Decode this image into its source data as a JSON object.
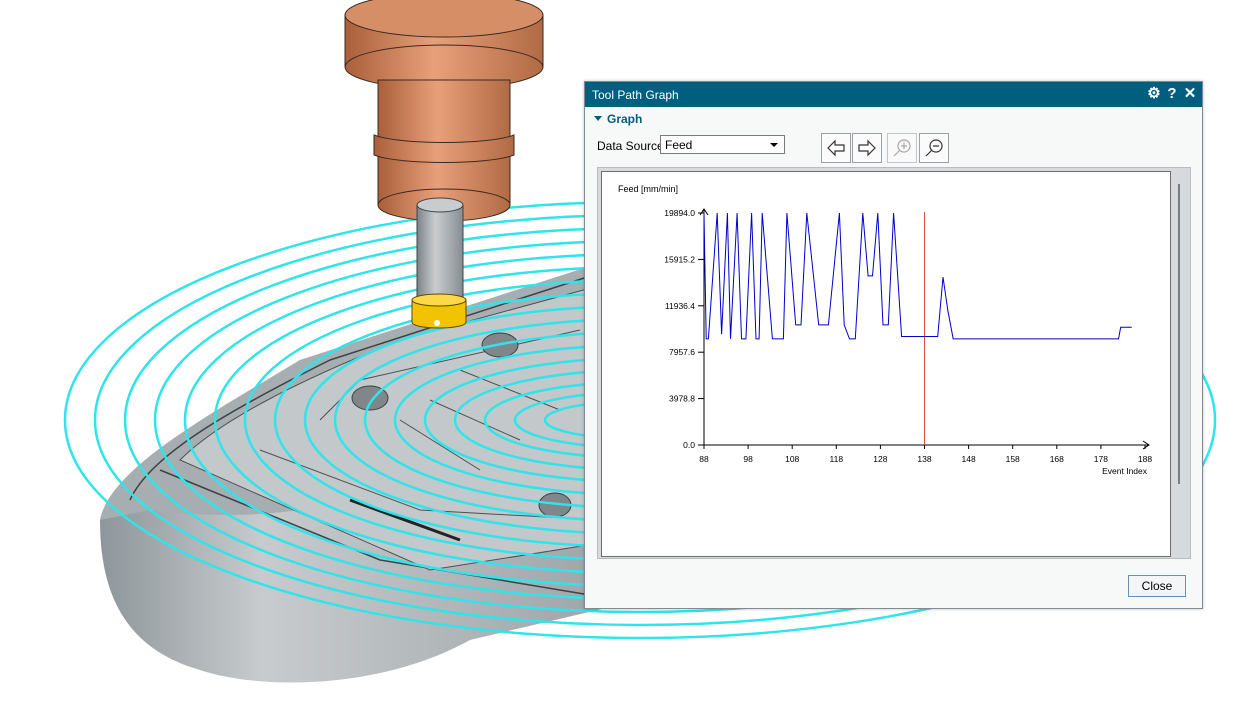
{
  "dialog": {
    "title": "Tool Path Graph",
    "icons": [
      "gear-icon",
      "help-icon",
      "close-icon"
    ],
    "group_label": "Graph",
    "data_source_label": "Data Source",
    "data_source_value": "Feed",
    "toolbar": [
      "arrow-left-icon",
      "arrow-right-icon",
      "zoom-in-icon",
      "zoom-out-icon"
    ],
    "close_label": "Close",
    "accent_color": "#005f7f"
  },
  "chart_data": {
    "type": "line",
    "ylabel": "Feed [mm/min]",
    "xlabel": "Event Index",
    "yticks": [
      "0.0",
      "3978.8",
      "7957.6",
      "11936.4",
      "15915.2",
      "19894.0"
    ],
    "ytick_values": [
      0,
      3978.8,
      7957.6,
      11936.4,
      15915.2,
      19894.0
    ],
    "xticks": [
      "88",
      "98",
      "108",
      "118",
      "128",
      "138",
      "148",
      "158",
      "168",
      "178",
      "188"
    ],
    "xtick_values": [
      88,
      98,
      108,
      118,
      128,
      138,
      148,
      158,
      168,
      178,
      188
    ],
    "xlim": [
      88,
      188
    ],
    "ylim": [
      0,
      19894
    ],
    "series": [
      {
        "color": "#0000cc",
        "x": [
          88,
          88.5,
          89,
          91,
          92,
          93.3,
          94,
          95.5,
          96.5,
          97.5,
          98.8,
          99.8,
          100.5,
          101.2,
          103.5,
          104.3,
          106,
          106.8,
          108.8,
          110,
          111.3,
          114,
          116.2,
          118.7,
          119.8,
          121,
          122.3,
          124,
          125.2,
          126.2,
          127.4,
          128.6,
          129.8,
          131,
          132.8,
          134.8,
          136.2,
          138,
          139,
          141,
          142.2,
          143.3,
          144.5,
          146,
          178,
          180,
          180.5,
          182,
          182.5,
          183.5,
          185
        ],
        "y": [
          19894,
          9100,
          9100,
          19894,
          9500,
          19894,
          9100,
          19894,
          9100,
          9100,
          19894,
          9100,
          9100,
          19894,
          9100,
          9100,
          9100,
          19894,
          10300,
          10300,
          19894,
          10300,
          10300,
          19894,
          10300,
          9100,
          9100,
          19894,
          14500,
          14500,
          19894,
          10300,
          10300,
          19894,
          9300,
          9300,
          9300,
          9300,
          9300,
          9300,
          14400,
          11500,
          9100,
          9100,
          9100,
          9100,
          9100,
          9100,
          10100,
          10100,
          10100
        ]
      }
    ],
    "marker_x": 138,
    "marker_color": "#e05040"
  }
}
